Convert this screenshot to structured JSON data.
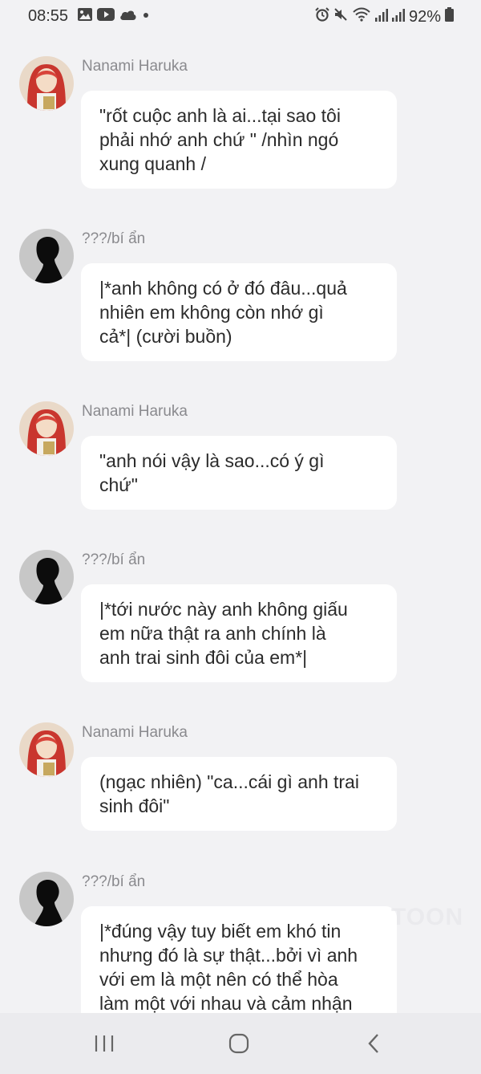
{
  "status_bar": {
    "time": "08:55",
    "battery": "92%",
    "left_icons": [
      "gallery-icon",
      "youtube-icon",
      "cloud-icon",
      "dot-icon"
    ],
    "right_icons": [
      "alarm-icon",
      "mute-icon",
      "wifi-icon",
      "signal-icon",
      "signal-icon",
      "battery-icon"
    ]
  },
  "messages": [
    {
      "sender": "Nanami Haruka",
      "avatar": "nanami-avatar",
      "text": "\"rốt cuộc anh là ai...tại sao tôi\nphải nhớ anh chứ \" /nhìn ngó\nxung quanh /"
    },
    {
      "sender": "???/bí ẩn",
      "avatar": "mystery-avatar",
      "text": "|*anh không có ở đó đâu...quả\nnhiên em không còn nhớ gì\ncả*| (cười buồn)"
    },
    {
      "sender": "Nanami Haruka",
      "avatar": "nanami-avatar",
      "text": "\"anh nói vậy là sao...có ý gì\nchứ\""
    },
    {
      "sender": "???/bí ẩn",
      "avatar": "mystery-avatar",
      "text": "|*tới nước này anh không giấu\nem nữa thật ra anh chính là\nanh trai sinh đôi của em*|"
    },
    {
      "sender": "Nanami Haruka",
      "avatar": "nanami-avatar",
      "text": "(ngạc nhiên) \"ca...cái gì anh trai\nsinh đôi\""
    },
    {
      "sender": "???/bí ẩn",
      "avatar": "mystery-avatar",
      "text": "|*đúng vậy tuy biết em khó tin\nnhưng đó là sự thật...bởi vì anh\nvới em là một nên có thể hòa\nlàm một với nhau và cảm nhận"
    }
  ],
  "watermark": "TOON",
  "nav_bar": {
    "buttons": [
      "recent-apps-icon",
      "home-icon",
      "back-icon"
    ]
  },
  "colors": {
    "background": "#f2f2f4",
    "bubble": "#ffffff",
    "sender_text": "#8a8a8e",
    "message_text": "#2b2b2b",
    "nav_bar": "#ebebee"
  }
}
